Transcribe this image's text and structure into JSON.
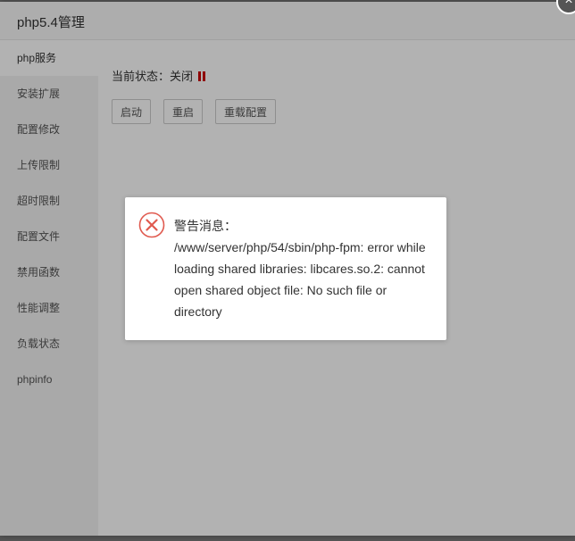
{
  "window": {
    "title": "php5.4管理",
    "close_symbol": "×"
  },
  "sidebar": {
    "items": [
      {
        "label": "php服务",
        "active": true
      },
      {
        "label": "安装扩展"
      },
      {
        "label": "配置修改"
      },
      {
        "label": "上传限制"
      },
      {
        "label": "超时限制"
      },
      {
        "label": "配置文件"
      },
      {
        "label": "禁用函数"
      },
      {
        "label": "性能调整"
      },
      {
        "label": "负载状态"
      },
      {
        "label": "phpinfo"
      }
    ]
  },
  "main": {
    "status_label": "当前状态：关闭",
    "status_icon": "stop-icon",
    "status_color": "#cc0000",
    "buttons": {
      "start": "启动",
      "restart": "重启",
      "reload": "重载配置"
    }
  },
  "alert": {
    "icon": "error-icon",
    "icon_color": "#e05a4f",
    "title": "警告消息：",
    "message": "/www/server/php/54/sbin/php-fpm: error while loading shared libraries: libcares.so.2: cannot open shared object file: No such file or directory"
  }
}
